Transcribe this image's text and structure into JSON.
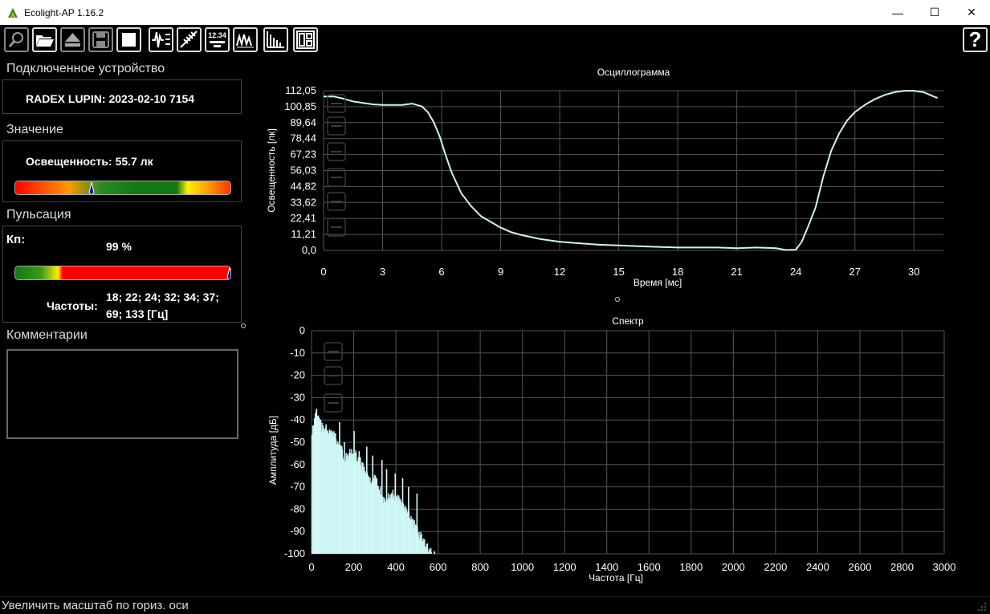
{
  "window": {
    "title": "Ecolight-AP 1.16.2",
    "minimize_glyph": "—",
    "maximize_glyph": "☐",
    "close_glyph": "✕"
  },
  "toolbar": {
    "items": [
      "search-icon",
      "open-folder-icon",
      "eject-icon",
      "save-icon",
      "stop-icon",
      "oscillogram-icon",
      "pulse-icon",
      "value-display-icon",
      "waveform-icon",
      "spectrum-icon",
      "layout-icon"
    ],
    "value_display_text": "12.34",
    "help_glyph": "?"
  },
  "device": {
    "section_title": "Подключенное устройство",
    "name": "RADEX LUPIN: 2023-02-10 7154"
  },
  "value": {
    "section_title": "Значение",
    "reading": "Освещенность: 55.7 лк",
    "bar_level": 0.35
  },
  "pulsation": {
    "section_title": "Пульсация",
    "kp_label": "Кп:",
    "kp_value": "99 %",
    "bar_level": 0.99,
    "freq_label": "Частоты:",
    "freq_line1": "18; 22; 24; 32; 34; 37;",
    "freq_line2": "69; 133 [Гц]"
  },
  "comments": {
    "section_title": "Комментарии",
    "text": ""
  },
  "status": {
    "text": "Увеличить масштаб по гориз. оси"
  },
  "colors": {
    "line": "#cff3f3",
    "spectrum_fill": "#ccf5f5",
    "grid": "#555555",
    "bar_red": "#ff0000",
    "bar_green": "#1a8a1a",
    "bar_yellow": "#ffee00"
  },
  "chart_data": [
    {
      "type": "line",
      "title": "Осциллограмма",
      "xlabel": "Время [мс]",
      "ylabel": "Освещенность [лк]",
      "xlim": [
        0,
        31.5
      ],
      "ylim": [
        0,
        112.05
      ],
      "x_ticks": [
        "0",
        "3",
        "6",
        "9",
        "12",
        "15",
        "18",
        "21",
        "24",
        "27",
        "30"
      ],
      "y_ticks": [
        "0,0",
        "11,21",
        "22,41",
        "33,62",
        "44,82",
        "56,03",
        "67,23",
        "78,44",
        "89,64",
        "100,85",
        "112,05"
      ],
      "grid": true,
      "series": [
        {
          "x": [
            0,
            0.5,
            1,
            1.5,
            2,
            2.5,
            3,
            3.5,
            4,
            4.5,
            5,
            5.3,
            5.6,
            5.9,
            6.2,
            6.5,
            7,
            7.5,
            8,
            8.5,
            9,
            9.5,
            10,
            11,
            12,
            13,
            14,
            15,
            16,
            17,
            18,
            19,
            20,
            21,
            22,
            23,
            23.5,
            24,
            24.3,
            24.6,
            25,
            25.4,
            25.8,
            26.2,
            26.6,
            27,
            27.5,
            28,
            28.5,
            29,
            29.5,
            30,
            30.5,
            31,
            31.2
          ],
          "y": [
            108,
            108,
            106.5,
            104.5,
            103.5,
            102.5,
            102,
            102,
            102,
            103,
            101,
            97,
            90,
            80,
            67,
            55,
            40,
            31,
            24,
            20,
            16,
            13,
            11,
            8,
            6,
            5,
            4,
            3.5,
            3,
            2.5,
            2,
            2,
            2,
            1.5,
            2,
            1.5,
            0.3,
            0.5,
            6,
            16,
            30,
            52,
            70,
            82,
            91,
            97,
            102,
            106,
            109,
            111,
            112,
            112,
            111,
            108,
            107
          ]
        }
      ]
    },
    {
      "type": "bar",
      "title": "Спектр",
      "xlabel": "Частота [Гц]",
      "ylabel": "Амплитуда [дБ]",
      "xlim": [
        0,
        3000
      ],
      "ylim": [
        -100,
        0
      ],
      "x_ticks": [
        "0",
        "200",
        "400",
        "600",
        "800",
        "1000",
        "1200",
        "1400",
        "1600",
        "1800",
        "2000",
        "2200",
        "2400",
        "2600",
        "2800",
        "3000"
      ],
      "y_ticks": [
        "0",
        "-10",
        "-20",
        "-30",
        "-40",
        "-50",
        "-60",
        "-70",
        "-80",
        "-90",
        "-100"
      ],
      "grid": true,
      "envelope": {
        "x": [
          0,
          10,
          20,
          40,
          60,
          80,
          100,
          120,
          140,
          160,
          180,
          200,
          220,
          240,
          260,
          280,
          300,
          320,
          340,
          360,
          380,
          400,
          420,
          440,
          460,
          480,
          500,
          520,
          540,
          560,
          580,
          600
        ],
        "y": [
          -45,
          -40,
          -37,
          -39,
          -42,
          -44,
          -43,
          -47,
          -50,
          -55,
          -53,
          -52,
          -55,
          -58,
          -63,
          -66,
          -64,
          -68,
          -72,
          -73,
          -70,
          -73,
          -74,
          -77,
          -80,
          -84,
          -86,
          -90,
          -93,
          -96,
          -98,
          -100
        ]
      },
      "peaks": {
        "x": [
          18,
          22,
          24,
          32,
          34,
          37,
          69,
          133,
          156,
          202,
          226,
          262,
          290,
          334,
          356,
          397,
          432,
          460,
          500
        ],
        "y": [
          -37,
          -36,
          -35,
          -38,
          -39,
          -39,
          -42,
          -41,
          -50,
          -45,
          -54,
          -52,
          -56,
          -58,
          -62,
          -64,
          -66,
          -70,
          -73
        ]
      }
    }
  ]
}
